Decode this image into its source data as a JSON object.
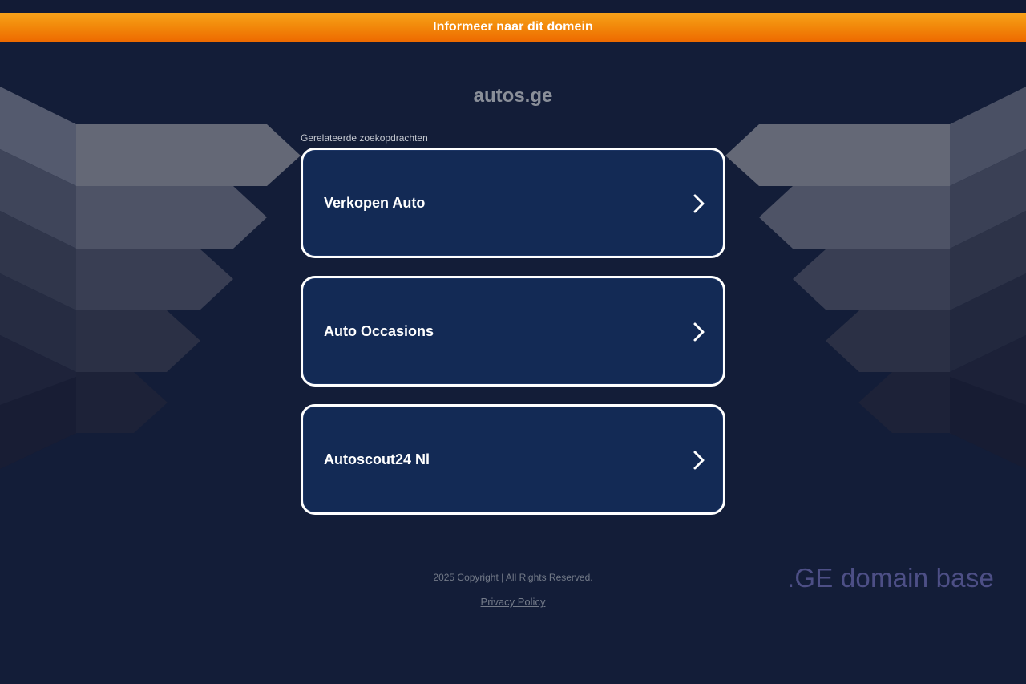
{
  "banner": {
    "label": "Informeer naar dit domein"
  },
  "domain": {
    "title": "autos.ge"
  },
  "related": {
    "heading": "Gerelateerde zoekopdrachten",
    "items": [
      {
        "label": "Verkopen Auto"
      },
      {
        "label": "Auto Occasions"
      },
      {
        "label": "Autoscout24 Nl"
      }
    ]
  },
  "footer": {
    "copyright": "2025 Copyright | All Rights Reserved.",
    "privacy": "Privacy Policy"
  },
  "brand": {
    "label": ".GE domain base"
  },
  "colors": {
    "banner_orange": "#f28a0b",
    "background": "#131d38",
    "card_fill": "#132a55",
    "card_border": "#ffffff",
    "brand_text": "#4d4f86"
  },
  "icons": [
    "chevron-right-icon"
  ]
}
